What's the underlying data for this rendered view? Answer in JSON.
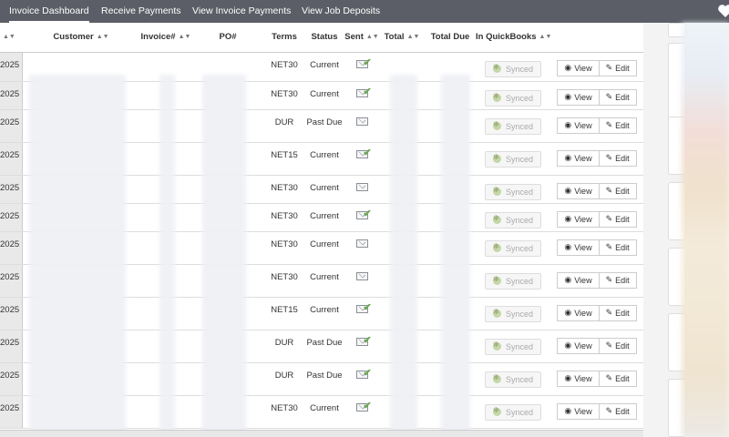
{
  "nav": {
    "tabs": [
      {
        "label": "Invoice Dashboard",
        "active": true
      },
      {
        "label": "Receive Payments",
        "active": false
      },
      {
        "label": "View Invoice Payments",
        "active": false
      },
      {
        "label": "View Job Deposits",
        "active": false
      }
    ],
    "heart_icon": "heart-icon"
  },
  "table": {
    "columns": {
      "customer": "Customer",
      "invoice": "Invoice#",
      "po": "PO#",
      "terms": "Terms",
      "status": "Status",
      "sent": "Sent",
      "total": "Total",
      "total_due": "Total Due",
      "in_quickbooks": "In QuickBooks"
    },
    "synced_label": "Synced",
    "view_label": "View",
    "edit_label": "Edit",
    "rows": [
      {
        "date": "2025",
        "terms": "NET30",
        "status": "Current",
        "sent_check": true
      },
      {
        "date": "2025",
        "terms": "NET30",
        "status": "Current",
        "sent_check": true
      },
      {
        "date": "2025",
        "terms": "DUR",
        "status": "Past Due",
        "sent_check": false
      },
      {
        "date": "2025",
        "terms": "NET15",
        "status": "Current",
        "sent_check": true
      },
      {
        "date": "2025",
        "terms": "NET30",
        "status": "Current",
        "sent_check": false
      },
      {
        "date": "2025",
        "terms": "NET30",
        "status": "Current",
        "sent_check": true
      },
      {
        "date": "2025",
        "terms": "NET30",
        "status": "Current",
        "sent_check": false
      },
      {
        "date": "2025",
        "terms": "NET30",
        "status": "Current",
        "sent_check": false
      },
      {
        "date": "2025",
        "terms": "NET15",
        "status": "Current",
        "sent_check": true
      },
      {
        "date": "2025",
        "terms": "DUR",
        "status": "Past Due",
        "sent_check": true
      },
      {
        "date": "2025",
        "terms": "DUR",
        "status": "Past Due",
        "sent_check": true
      },
      {
        "date": "2025",
        "terms": "NET30",
        "status": "Current",
        "sent_check": true
      }
    ]
  },
  "icons": {
    "sort": "sort-icon",
    "envelope": "envelope-icon",
    "quickbooks": "quickbooks-icon",
    "eye": "eye-icon",
    "pencil": "pencil-icon"
  }
}
